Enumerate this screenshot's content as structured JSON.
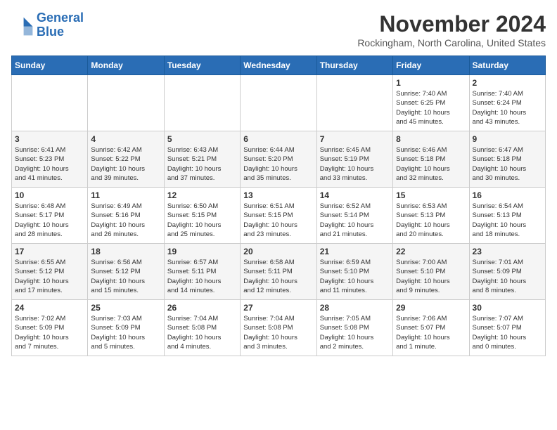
{
  "logo": {
    "line1": "General",
    "line2": "Blue"
  },
  "title": "November 2024",
  "location": "Rockingham, North Carolina, United States",
  "days_of_week": [
    "Sunday",
    "Monday",
    "Tuesday",
    "Wednesday",
    "Thursday",
    "Friday",
    "Saturday"
  ],
  "weeks": [
    [
      {
        "num": "",
        "info": ""
      },
      {
        "num": "",
        "info": ""
      },
      {
        "num": "",
        "info": ""
      },
      {
        "num": "",
        "info": ""
      },
      {
        "num": "",
        "info": ""
      },
      {
        "num": "1",
        "info": "Sunrise: 7:40 AM\nSunset: 6:25 PM\nDaylight: 10 hours\nand 45 minutes."
      },
      {
        "num": "2",
        "info": "Sunrise: 7:40 AM\nSunset: 6:24 PM\nDaylight: 10 hours\nand 43 minutes."
      }
    ],
    [
      {
        "num": "3",
        "info": "Sunrise: 6:41 AM\nSunset: 5:23 PM\nDaylight: 10 hours\nand 41 minutes."
      },
      {
        "num": "4",
        "info": "Sunrise: 6:42 AM\nSunset: 5:22 PM\nDaylight: 10 hours\nand 39 minutes."
      },
      {
        "num": "5",
        "info": "Sunrise: 6:43 AM\nSunset: 5:21 PM\nDaylight: 10 hours\nand 37 minutes."
      },
      {
        "num": "6",
        "info": "Sunrise: 6:44 AM\nSunset: 5:20 PM\nDaylight: 10 hours\nand 35 minutes."
      },
      {
        "num": "7",
        "info": "Sunrise: 6:45 AM\nSunset: 5:19 PM\nDaylight: 10 hours\nand 33 minutes."
      },
      {
        "num": "8",
        "info": "Sunrise: 6:46 AM\nSunset: 5:18 PM\nDaylight: 10 hours\nand 32 minutes."
      },
      {
        "num": "9",
        "info": "Sunrise: 6:47 AM\nSunset: 5:18 PM\nDaylight: 10 hours\nand 30 minutes."
      }
    ],
    [
      {
        "num": "10",
        "info": "Sunrise: 6:48 AM\nSunset: 5:17 PM\nDaylight: 10 hours\nand 28 minutes."
      },
      {
        "num": "11",
        "info": "Sunrise: 6:49 AM\nSunset: 5:16 PM\nDaylight: 10 hours\nand 26 minutes."
      },
      {
        "num": "12",
        "info": "Sunrise: 6:50 AM\nSunset: 5:15 PM\nDaylight: 10 hours\nand 25 minutes."
      },
      {
        "num": "13",
        "info": "Sunrise: 6:51 AM\nSunset: 5:15 PM\nDaylight: 10 hours\nand 23 minutes."
      },
      {
        "num": "14",
        "info": "Sunrise: 6:52 AM\nSunset: 5:14 PM\nDaylight: 10 hours\nand 21 minutes."
      },
      {
        "num": "15",
        "info": "Sunrise: 6:53 AM\nSunset: 5:13 PM\nDaylight: 10 hours\nand 20 minutes."
      },
      {
        "num": "16",
        "info": "Sunrise: 6:54 AM\nSunset: 5:13 PM\nDaylight: 10 hours\nand 18 minutes."
      }
    ],
    [
      {
        "num": "17",
        "info": "Sunrise: 6:55 AM\nSunset: 5:12 PM\nDaylight: 10 hours\nand 17 minutes."
      },
      {
        "num": "18",
        "info": "Sunrise: 6:56 AM\nSunset: 5:12 PM\nDaylight: 10 hours\nand 15 minutes."
      },
      {
        "num": "19",
        "info": "Sunrise: 6:57 AM\nSunset: 5:11 PM\nDaylight: 10 hours\nand 14 minutes."
      },
      {
        "num": "20",
        "info": "Sunrise: 6:58 AM\nSunset: 5:11 PM\nDaylight: 10 hours\nand 12 minutes."
      },
      {
        "num": "21",
        "info": "Sunrise: 6:59 AM\nSunset: 5:10 PM\nDaylight: 10 hours\nand 11 minutes."
      },
      {
        "num": "22",
        "info": "Sunrise: 7:00 AM\nSunset: 5:10 PM\nDaylight: 10 hours\nand 9 minutes."
      },
      {
        "num": "23",
        "info": "Sunrise: 7:01 AM\nSunset: 5:09 PM\nDaylight: 10 hours\nand 8 minutes."
      }
    ],
    [
      {
        "num": "24",
        "info": "Sunrise: 7:02 AM\nSunset: 5:09 PM\nDaylight: 10 hours\nand 7 minutes."
      },
      {
        "num": "25",
        "info": "Sunrise: 7:03 AM\nSunset: 5:09 PM\nDaylight: 10 hours\nand 5 minutes."
      },
      {
        "num": "26",
        "info": "Sunrise: 7:04 AM\nSunset: 5:08 PM\nDaylight: 10 hours\nand 4 minutes."
      },
      {
        "num": "27",
        "info": "Sunrise: 7:04 AM\nSunset: 5:08 PM\nDaylight: 10 hours\nand 3 minutes."
      },
      {
        "num": "28",
        "info": "Sunrise: 7:05 AM\nSunset: 5:08 PM\nDaylight: 10 hours\nand 2 minutes."
      },
      {
        "num": "29",
        "info": "Sunrise: 7:06 AM\nSunset: 5:07 PM\nDaylight: 10 hours\nand 1 minute."
      },
      {
        "num": "30",
        "info": "Sunrise: 7:07 AM\nSunset: 5:07 PM\nDaylight: 10 hours\nand 0 minutes."
      }
    ]
  ]
}
